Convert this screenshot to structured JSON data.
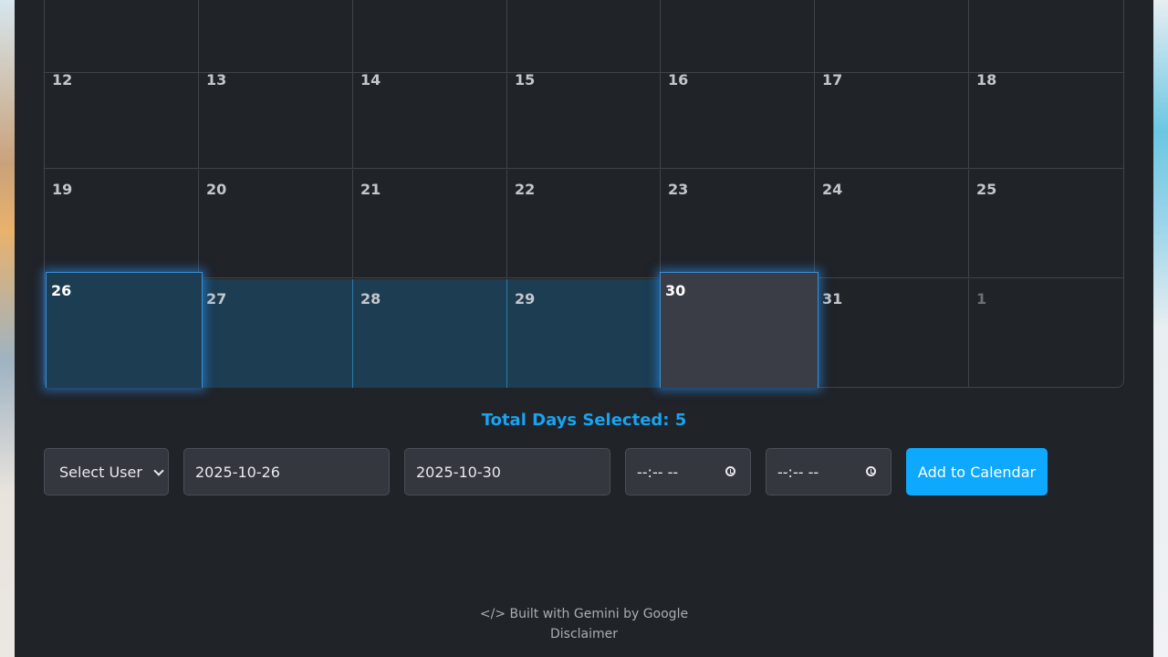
{
  "calendar": {
    "weeks": [
      {
        "days": [
          "",
          "",
          "",
          "",
          "",
          "",
          ""
        ]
      },
      {
        "days": [
          "12",
          "13",
          "14",
          "15",
          "16",
          "17",
          "18"
        ]
      },
      {
        "days": [
          "19",
          "20",
          "21",
          "22",
          "23",
          "24",
          "25"
        ]
      },
      {
        "days": [
          "26",
          "27",
          "28",
          "29",
          "30",
          "31",
          "1"
        ]
      }
    ]
  },
  "summary": {
    "total_label": "Total Days Selected: 5"
  },
  "form": {
    "user_select": "Select User",
    "start_date": "2025-10-26",
    "end_date": "2025-10-30",
    "start_time": "--:-- --",
    "end_time": "--:-- --",
    "add_button": "Add to Calendar"
  },
  "footer": {
    "built_with": "</> Built with Gemini by Google",
    "disclaimer": "Disclaimer"
  },
  "colors": {
    "accent": "#0ea8ff",
    "selected_range": "#1c3d52",
    "panel_bg": "#202328"
  }
}
